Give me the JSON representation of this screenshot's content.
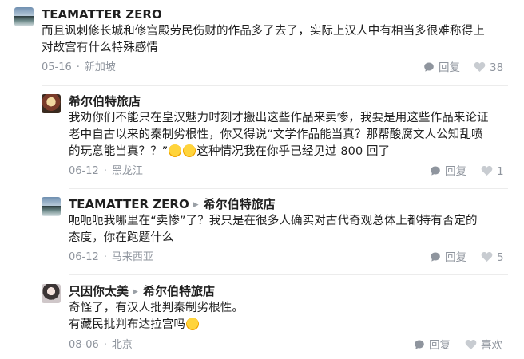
{
  "comments": [
    {
      "name": "TEAMATTER ZERO",
      "reply_to": "",
      "text_lines": [
        "而且讽刺修长城和修宫殿劳民伤财的作品多了去了，实际上汉人中有相当多很难称得上",
        "对故宫有什么特殊感情"
      ],
      "date": "05-16",
      "location": "新加坡",
      "reply_label": "回复",
      "likes": "38"
    },
    {
      "name": "希尔伯特旅店",
      "reply_to": "",
      "text_lines": [
        "我劝你们不能只在皇汉魅力时刻才搬出这些作品来卖惨，我要是用这些作品来论证",
        "老中自古以来的秦制劣根性，你又得说“文学作品能当真？那帮酸腐文人公知乱喷",
        "的玩意能当真？？”",
        "这种情况我在你乎已经见过 800 回了"
      ],
      "date": "06-12",
      "location": "黑龙江",
      "reply_label": "回复",
      "likes": "1"
    },
    {
      "name": "TEAMATTER ZERO",
      "reply_to": "希尔伯特旅店",
      "text_lines": [
        "呃呃呃我哪里在“卖惨”了？我只是在很多人确实对古代奇观总体上都持有否定的",
        "态度，你在跑题什么"
      ],
      "date": "06-12",
      "location": "马来西亚",
      "reply_label": "回复",
      "likes": "5"
    },
    {
      "name": "只因你太美",
      "reply_to": "希尔伯特旅店",
      "text_lines": [
        "奇怪了，有汉人批判秦制劣根性。",
        "有藏民批判布达拉宫吗"
      ],
      "date": "08-06",
      "location": "北京",
      "reply_label": "回复",
      "likes": "喜欢"
    }
  ],
  "icons": {
    "reply": "chat-bubble-icon",
    "like": "heart-icon",
    "emoji": "laughing-emoji-icon"
  },
  "colors": {
    "text": "#1f1f1f",
    "meta": "#8f959e",
    "separator": "#ececec"
  }
}
